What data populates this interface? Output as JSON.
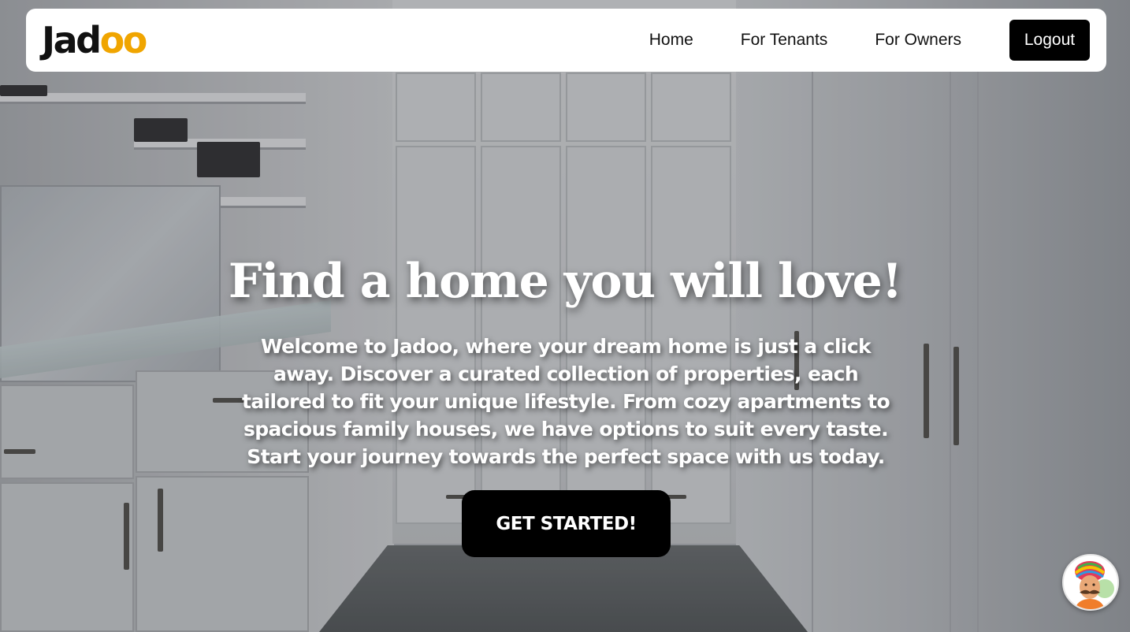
{
  "brand": {
    "logo_prefix": "Jad",
    "logo_suffix": "oo"
  },
  "nav": {
    "items": [
      {
        "label": "Home"
      },
      {
        "label": "For Tenants"
      },
      {
        "label": "For Owners"
      }
    ],
    "logout_label": "Logout"
  },
  "hero": {
    "title": "Find a home you will love!",
    "description": "Welcome to Jadoo, where your dream home is just a click away. Discover a curated collection of properties, each tailored to fit your unique lifestyle. From cozy apartments to spacious family houses, we have options to suit every taste. Start your journey towards the perfect space with us today.",
    "cta_label": "GET STARTED!"
  },
  "colors": {
    "logo_accent": "#f0a500",
    "navbar_bg": "#ffffff",
    "button_bg": "#000000",
    "hero_text": "#ffffff"
  },
  "icons": {
    "assistant_avatar": "turbaned-man-avatar-icon"
  }
}
